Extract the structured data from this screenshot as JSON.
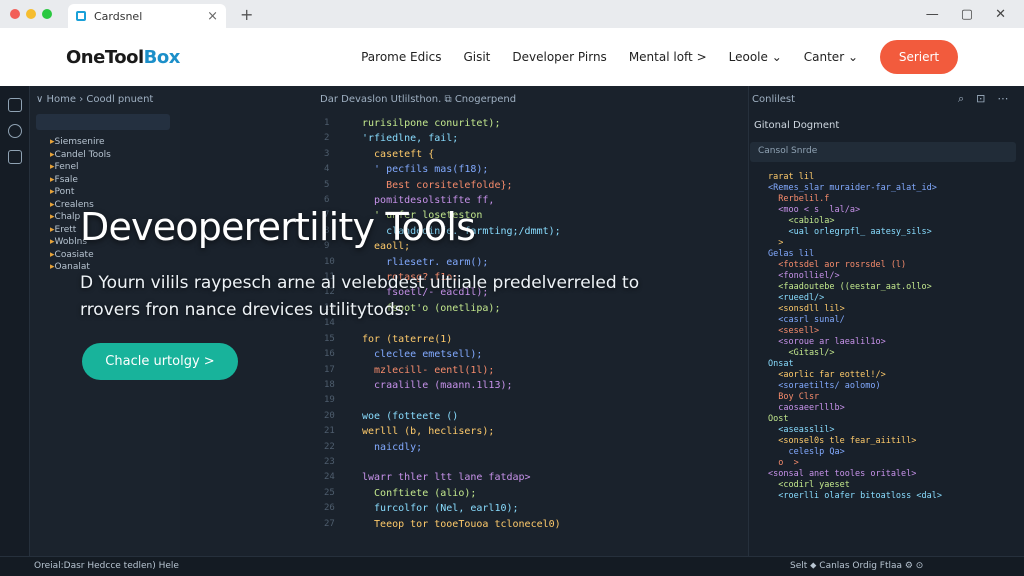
{
  "browser": {
    "tab_title": "Cardsnel",
    "close_glyph": "×",
    "new_tab_glyph": "+",
    "window_controls": [
      "—",
      "▢",
      "✕"
    ],
    "colors": {
      "close": "#f25f58",
      "min": "#f6bd2f",
      "max": "#2ac840"
    }
  },
  "site": {
    "logo_part1": "OneTool",
    "logo_part2": "Box",
    "nav": [
      "Parome Edics",
      "Gisit",
      "Developer Pirns",
      "Mental loft >",
      "Leoole ⌄",
      "Canter ⌄"
    ],
    "cta_label": "Seriert",
    "accent": "#f25b3d"
  },
  "ide": {
    "breadcrumb": "∨ Home  ›  Coodl pnuent",
    "explorer_tree": [
      "Siemsenire",
      "Candel Tools",
      "Fenel",
      "Fsale",
      "Pont",
      "Crealens",
      "Chalp",
      "Erett",
      "Woblns",
      "Coasiate",
      "Oanalat"
    ],
    "editor_header": "Dar Devaslon Utlilsthon.    ⧉ Cnogerpend",
    "code_lines": [
      "rurisilpone conuritet);",
      "'rfiedlne, fail;",
      "  caseteft {",
      "  ' pecfils mas(f18);",
      "    Best corsitelefolde};",
      "  pomitdesolstifte ff,",
      "  ' unfer loseteston",
      "    clandedinfe. farmting;/dmmt);",
      "  eaoll;",
      "    rliesetr. earm();",
      "    rotasg?.f1o;",
      "    fsoetl/- eacd1l);",
      "    fsoot'o (onetlipa);",
      "",
      "for (taterre(1)",
      "  cleclee emetsell);",
      "  mzlecill- eentl(1l);",
      "  craalille (maann.1l13);",
      "",
      "woe (fotteete ()",
      "werlll (b, heclisers);",
      "  naicdly;",
      "",
      "lwarr thler ltt lane fatdap>",
      "  Conftiete (alio);",
      "  furcolfor (Nel, earl10);",
      "  Teeop tor tooeTouoa tclonecel0)"
    ],
    "right_panel": {
      "title": "Conlilest",
      "icons": [
        "⌕",
        "⊡",
        "⋯"
      ],
      "subtitle": "Gitonal Dogment",
      "filter_label": "Cansol  Snrde",
      "code": [
        "rarat lil",
        "<Remes_slar muraider-far_alat_id>",
        "  Rerbelil.f",
        "  <moo < s  lal/a>",
        "    <cabiola>",
        "    <ual orlegrpfl_ aatesy_sils>",
        "  >",
        "Gelas lil",
        "  <fotsdel aor rosrsdel (l)",
        "  <fonolliel/>",
        "  <faadoutebe ((eestar_aat.ollo>",
        "  <rueedl/>",
        "  <sonsdll lil>",
        "  <casrl sunal/",
        "  <sesell>",
        "  <soroue ar laealil1o>",
        "    <Gitasl/>",
        "Onsat",
        "  <aorlic far eottel!/>",
        "  <soraetilts/ aolomo)",
        "  Boy Clsr",
        "  caosaeerlllb>",
        "Oost",
        "  <aseasslil>",
        "  <sonsel0s tle fear_aiitill>",
        "    celeslp Qa>",
        "  o  >",
        "<sonsal anet tooles oritalel>",
        "  <codirl yaeset",
        "  <roerlli olafer bitoatloss <dal>"
      ]
    },
    "status_left": "Oreial:Dasr  Hedcce tedlen) Hele",
    "status_right": "Selt    ⬥ Canlas Ordig Ftlaa  ⚙  ⊙"
  },
  "hero": {
    "title": "Deveoperertility Tools",
    "description": "D Yourn vilils raypesch arne al velebdest ultiiale predelverreled to rrovers fron nance drevices utilitytods.",
    "button_label": "Chacle urtolgy >",
    "button_color": "#18b39b"
  }
}
